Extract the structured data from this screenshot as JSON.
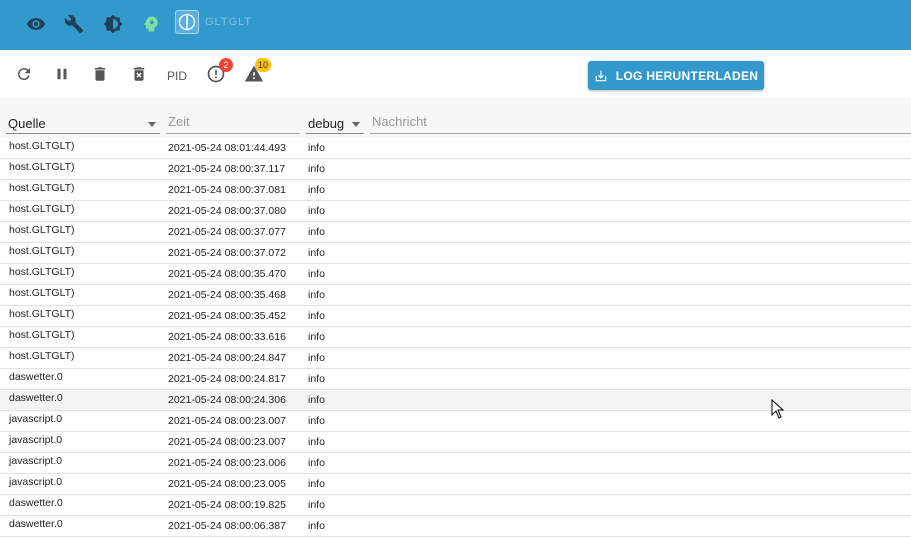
{
  "topbar": {
    "icons": [
      "eye-icon",
      "wrench-icon",
      "brightness-icon",
      "head-icon"
    ],
    "host_label": "GLTGLT"
  },
  "toolbar": {
    "icons": [
      "refresh-icon",
      "pause-icon",
      "trash-icon",
      "delete-file-icon"
    ],
    "pid_label": "PID",
    "error_count": "2",
    "warning_count": "10",
    "download_label": "LOG HERUNTERLADEN"
  },
  "filters": {
    "source_value": "Quelle",
    "time_placeholder": "Zeit",
    "severity_value": "debug",
    "message_placeholder": "Nachricht"
  },
  "rows": [
    {
      "source": "host.GLTGLT)",
      "time": "2021-05-24 08:01:44.493",
      "severity": "info",
      "message": ""
    },
    {
      "source": "host.GLTGLT)",
      "time": "2021-05-24 08:00:37.117",
      "severity": "info",
      "message": ""
    },
    {
      "source": "host.GLTGLT)",
      "time": "2021-05-24 08:00:37.081",
      "severity": "info",
      "message": ""
    },
    {
      "source": "host.GLTGLT)",
      "time": "2021-05-24 08:00:37.080",
      "severity": "info",
      "message": ""
    },
    {
      "source": "host.GLTGLT)",
      "time": "2021-05-24 08:00:37.077",
      "severity": "info",
      "message": ""
    },
    {
      "source": "host.GLTGLT)",
      "time": "2021-05-24 08:00:37.072",
      "severity": "info",
      "message": ""
    },
    {
      "source": "host.GLTGLT)",
      "time": "2021-05-24 08:00:35.470",
      "severity": "info",
      "message": ""
    },
    {
      "source": "host.GLTGLT)",
      "time": "2021-05-24 08:00:35.468",
      "severity": "info",
      "message": ""
    },
    {
      "source": "host.GLTGLT)",
      "time": "2021-05-24 08:00:35.452",
      "severity": "info",
      "message": ""
    },
    {
      "source": "host.GLTGLT)",
      "time": "2021-05-24 08:00:33.616",
      "severity": "info",
      "message": ""
    },
    {
      "source": "host.GLTGLT)",
      "time": "2021-05-24 08:00:24.847",
      "severity": "info",
      "message": ""
    },
    {
      "source": "daswetter.0",
      "time": "2021-05-24 08:00:24.817",
      "severity": "info",
      "message": ""
    },
    {
      "source": "daswetter.0",
      "time": "2021-05-24 08:00:24.306",
      "severity": "info",
      "message": ""
    },
    {
      "source": "javascript.0",
      "time": "2021-05-24 08:00:23.007",
      "severity": "info",
      "message": ""
    },
    {
      "source": "javascript.0",
      "time": "2021-05-24 08:00:23.007",
      "severity": "info",
      "message": ""
    },
    {
      "source": "javascript.0",
      "time": "2021-05-24 08:00:23.006",
      "severity": "info",
      "message": ""
    },
    {
      "source": "javascript.0",
      "time": "2021-05-24 08:00:23.005",
      "severity": "info",
      "message": ""
    },
    {
      "source": "daswetter.0",
      "time": "2021-05-24 08:00:19.825",
      "severity": "info",
      "message": ""
    },
    {
      "source": "daswetter.0",
      "time": "2021-05-24 08:00:06.387",
      "severity": "info",
      "message": ""
    }
  ]
}
